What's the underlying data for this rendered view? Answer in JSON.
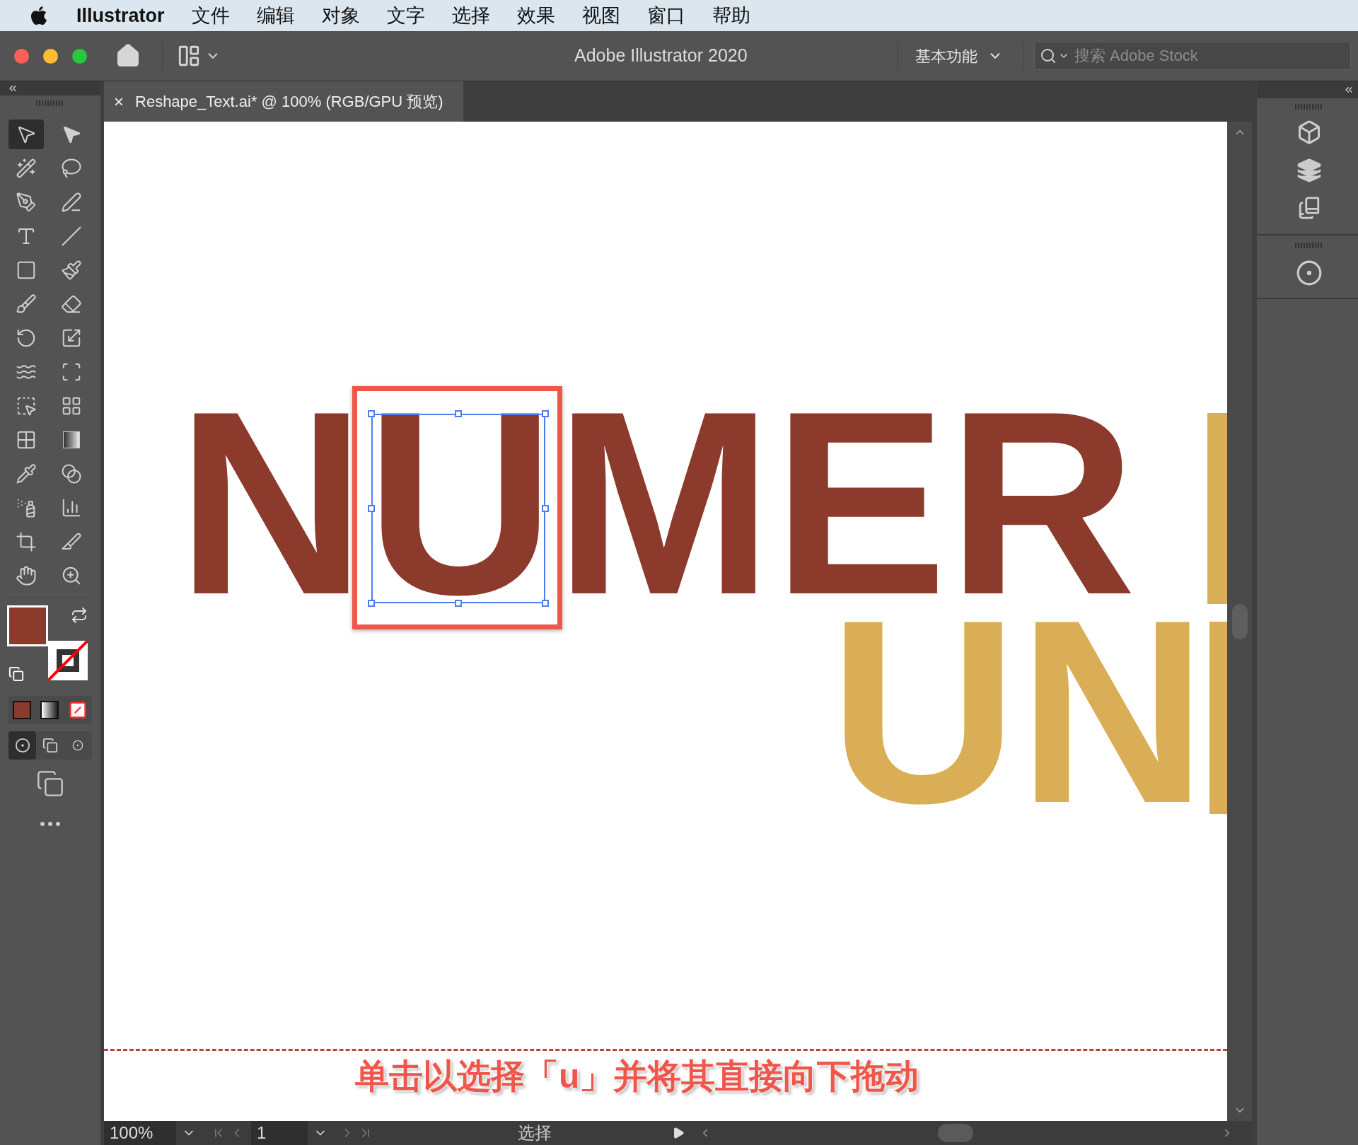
{
  "menu_bar": {
    "app": "Illustrator",
    "items": [
      "文件",
      "编辑",
      "对象",
      "文字",
      "选择",
      "效果",
      "视图",
      "窗口",
      "帮助"
    ]
  },
  "title_bar": {
    "title": "Adobe Illustrator 2020",
    "workspace": "基本功能",
    "search": {
      "placeholder": "搜索 Adobe Stock"
    }
  },
  "document_tab": {
    "close": "×",
    "title": "Reshape_Text.ai* @ 100% (RGB/GPU 预览)"
  },
  "tools": [
    {
      "selected": true
    },
    {
      "selected": false
    },
    {
      "selected": false
    },
    {
      "selected": false
    },
    {
      "selected": false
    },
    {
      "selected": false
    },
    {
      "selected": false
    },
    {
      "selected": false
    },
    {
      "selected": false
    },
    {
      "selected": false
    },
    {
      "selected": false
    },
    {
      "selected": false
    },
    {
      "selected": false
    },
    {
      "selected": false
    },
    {
      "selected": false
    },
    {
      "selected": false
    },
    {
      "selected": false
    },
    {
      "selected": false
    },
    {
      "selected": false
    },
    {
      "selected": false
    },
    {
      "selected": false
    },
    {
      "selected": false
    },
    {
      "selected": false
    },
    {
      "selected": false
    },
    {
      "selected": false
    },
    {
      "selected": false
    },
    {
      "selected": false
    },
    {
      "selected": false
    }
  ],
  "draw_modes": [
    {
      "selected": true
    },
    {
      "selected": false
    },
    {
      "selected": false
    }
  ],
  "artwork": {
    "line_1": "NUMER",
    "line_2": "UN"
  },
  "caption": "单击以选择「u」并将其直接向下拖动",
  "status_bar": {
    "zoom": "100%",
    "artboard": "1",
    "tool": "选择"
  }
}
